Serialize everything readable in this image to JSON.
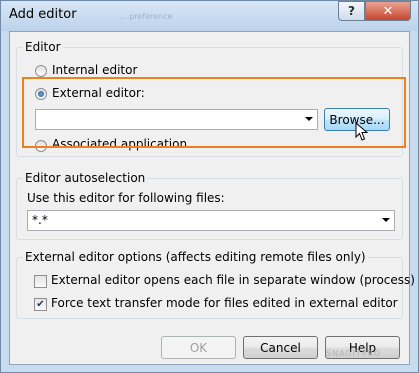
{
  "window": {
    "title": "Add editor",
    "ghost_title": "... preference"
  },
  "titlebar": {
    "help_glyph": "?",
    "close_glyph": "✕"
  },
  "editor_group": {
    "legend": "Editor",
    "internal_label": "Internal editor",
    "external_label": "External editor:",
    "external_value": "",
    "browse_label": "Browse...",
    "associated_label": "Associated application",
    "selected": "external"
  },
  "autoselect_group": {
    "legend": "Editor autoselection",
    "label": "Use this editor for following files:",
    "mask_value": "*.*"
  },
  "options_group": {
    "legend": "External editor options (affects editing remote files only)",
    "separate_window_label": "External editor opens each file in separate window (process)",
    "separate_window_checked": false,
    "force_text_label": "Force text transfer mode for files edited in external editor",
    "force_text_checked": true
  },
  "buttons": {
    "ok": "OK",
    "cancel": "Cancel",
    "help": "Help"
  },
  "watermark": "SNAGITPRO",
  "colors": {
    "highlight": "#f07f1e",
    "close_button": "#c7452e"
  }
}
